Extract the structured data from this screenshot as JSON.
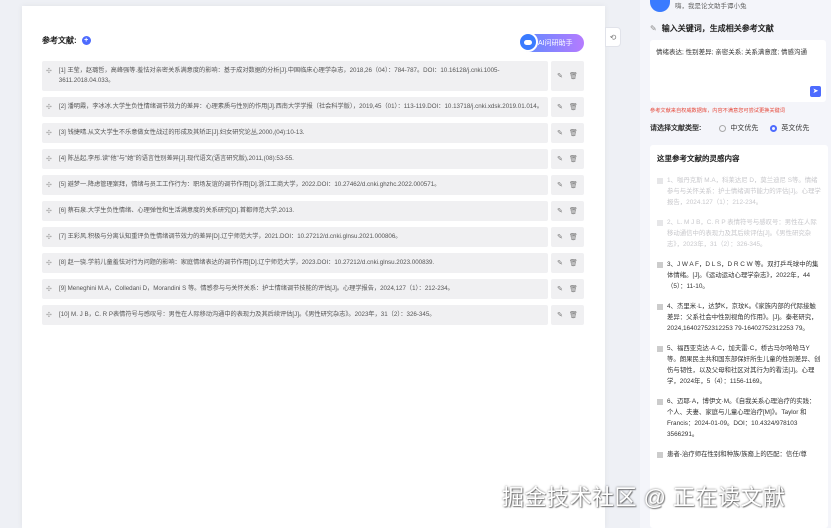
{
  "main": {
    "section_title": "参考文献:",
    "ai_button_label": "AI问研助手",
    "references": [
      {
        "text": "[1] 王莹，赵璐哲，高峰强等.羞怯对亲密关系满意度的影响：基于成对数据的分析[J].中国临床心理学杂志，2018,26（04）：784-787。DOI：10.16128/j.cnki.1005-3611.2018.04.033。"
      },
      {
        "text": "[2] 潘明霞，李冰冰.大学生负性情绪调节效力的差异：心理素质与性别的作用[J].西南大学学报（社会科学版），2019,45（01）：113-119.DOI：10.13718/j.cnki.xdsk.2019.01.014。"
      },
      {
        "text": "[3] 钱捷晴.从文大学生不乐意做女性战过的形成及其矫正[J].妇女研究论丛,2000,(04):10-13."
      },
      {
        "text": "[4] 陈丛起,李彤.读\"他\"与\"她\"的语言性别差异[J].现代语文(语言研究版),2011,(08):53-55."
      },
      {
        "text": "[5] 避梦一.降虑管理案拜，情绪与员工工作行为：职场友谊的调节作用[D].浙江工商大学，2022.DOI：10.27462/d.cnki.ghzhc.2022.000571。"
      },
      {
        "text": "[6] 蔡石泉.大学生负性情绪、心理弹性和生活满意度的关系研究[D].首都师范大学,2013."
      },
      {
        "text": "[7] 王彩风.积极与分离认知重评负性情绪调节效力的差异[D].辽宁师范大学，2021.DOI：10.27212/d.cnki.glnsu.2021.000806。"
      },
      {
        "text": "[8] 赵一骁.学前儿童羞怯对行为问题的影响：家庭情绪表达的调节作用[D].辽宁师范大学，2023.DOI：10.27212/d.cnki.glnsu.2023.000839."
      },
      {
        "text": "[9] Meneghini M.A，Colledani D，Morandini S 等。情感参与与关怀关系：护士情绪调节技能的评估[J]。心理学报告，2024,127（1）：212-234。"
      },
      {
        "text": "[10] M. J B，C. R P表情符号与感叹号：男性在人际移动沟通中的表现力及其后续评估[J]。《男性研究杂志》。2023年，31（2）：326-345。"
      }
    ]
  },
  "panel": {
    "greeting": "嗨，我是论文助手谭小兔",
    "keyword_title": "输入关键词，生成相关参考文献",
    "keyword_value": "情绪表达; 性别差异; 亲密关系; 关系满意度; 情感沟通",
    "keyword_hint": "参考文献来自权威数据库，内容不满意您可尝试更换关键词",
    "type_label": "请选择文献类型:",
    "option_cn": "中文优先",
    "option_en": "英文优先",
    "inspiration_title": "这里参考文献的灵感内容",
    "inspiration_items": [
      {
        "text": "1、咖丹克斯 M.A，科莱达尼 D，莫兰迪尼 S等。情绪参与与关怀关系：护士情绪调节能力的评估[J]。心理学报告，2024.127（1）：212-234。",
        "faded": true
      },
      {
        "text": "2、L. M J B，C. R P 表情符号与感叹号：男性在人际移动通信中的表现力及其后续评估[J]。《男性研究杂志》，2023年，31（2）：326-345。",
        "faded": true
      },
      {
        "text": "3、J W A F，D L S，D R C W 等。双打乒乓球中的集体情绪。[J]。《运动运动心理学杂志》，2022年，44（5）：11-10。",
        "faded": false
      },
      {
        "text": "4、杰里米·L，达梦K，京玟K。《家族内部的代际接触差异：父系社会中性别视角的作用》。[J]。秦老研究，2024,16402752312253 79-16402752312253 79。",
        "faded": false
      },
      {
        "text": "5、福西亚克达·A·C，加夫雷·C，桥古马尔哈哈马Y等。朗果民主共和国东部保奸所生儿童的性别差异、创伤与韧性，以及父母和社区对其行为的看法[J]。心理学，2024年，5（4）：1156-1169。",
        "faded": false
      },
      {
        "text": "6、迈耶·A，博伊文·M。《自我关系心理治疗的实践：个人、夫妻、家庭与儿童心理治疗[M]》。Taylor 和 Francis：2024-01-09。DOI：10.4324/978103 3566291。",
        "faded": false
      },
      {
        "text": "患者-治疗师在性别和种族/族裔上的匹配：信任/尊",
        "faded": false
      }
    ]
  },
  "watermark": "掘金技术社区 @ 正在读文献"
}
